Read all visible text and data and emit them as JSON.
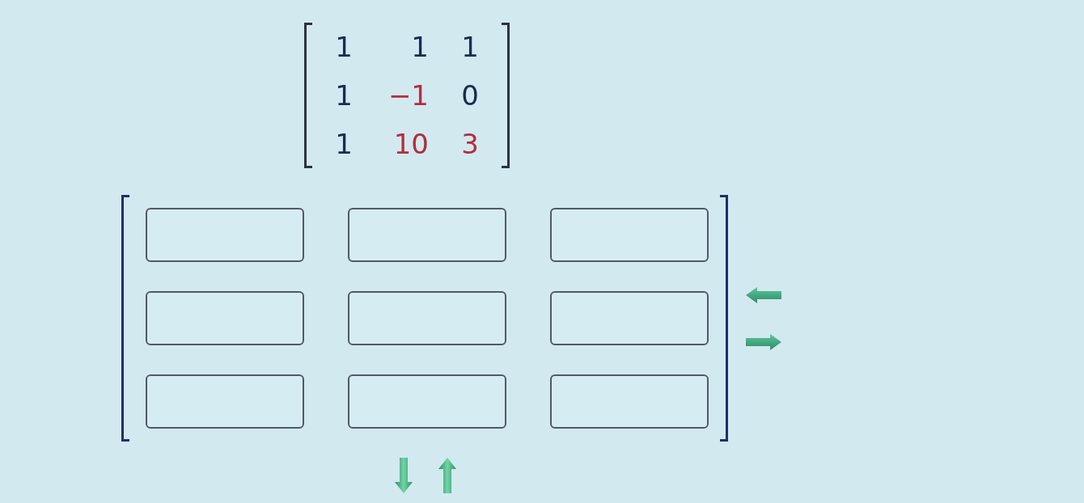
{
  "given_matrix": {
    "rows": [
      {
        "cells": [
          {
            "value": "1",
            "color": "#1c2b4f"
          },
          {
            "value": "1",
            "color": "#1c2b4f"
          },
          {
            "value": "1",
            "color": "#1c2b4f"
          }
        ]
      },
      {
        "cells": [
          {
            "value": "1",
            "color": "#1c2b4f"
          },
          {
            "value": "−1",
            "color": "#b0303c"
          },
          {
            "value": "0",
            "color": "#1c2b4f"
          }
        ]
      },
      {
        "cells": [
          {
            "value": "1",
            "color": "#1c2b4f"
          },
          {
            "value": "10",
            "color": "#b0303c"
          },
          {
            "value": "3",
            "color": "#b0303c"
          }
        ]
      }
    ]
  },
  "answer_matrix": {
    "rows": [
      {
        "cells": [
          {
            "kind": "input"
          },
          {
            "kind": "input"
          },
          {
            "kind": "input"
          }
        ]
      },
      {
        "cells": [
          {
            "kind": "input"
          },
          {
            "kind": "input"
          },
          {
            "kind": "input"
          }
        ]
      },
      {
        "cells": [
          {
            "kind": "input"
          },
          {
            "kind": "input"
          },
          {
            "kind": "input"
          }
        ]
      }
    ]
  }
}
